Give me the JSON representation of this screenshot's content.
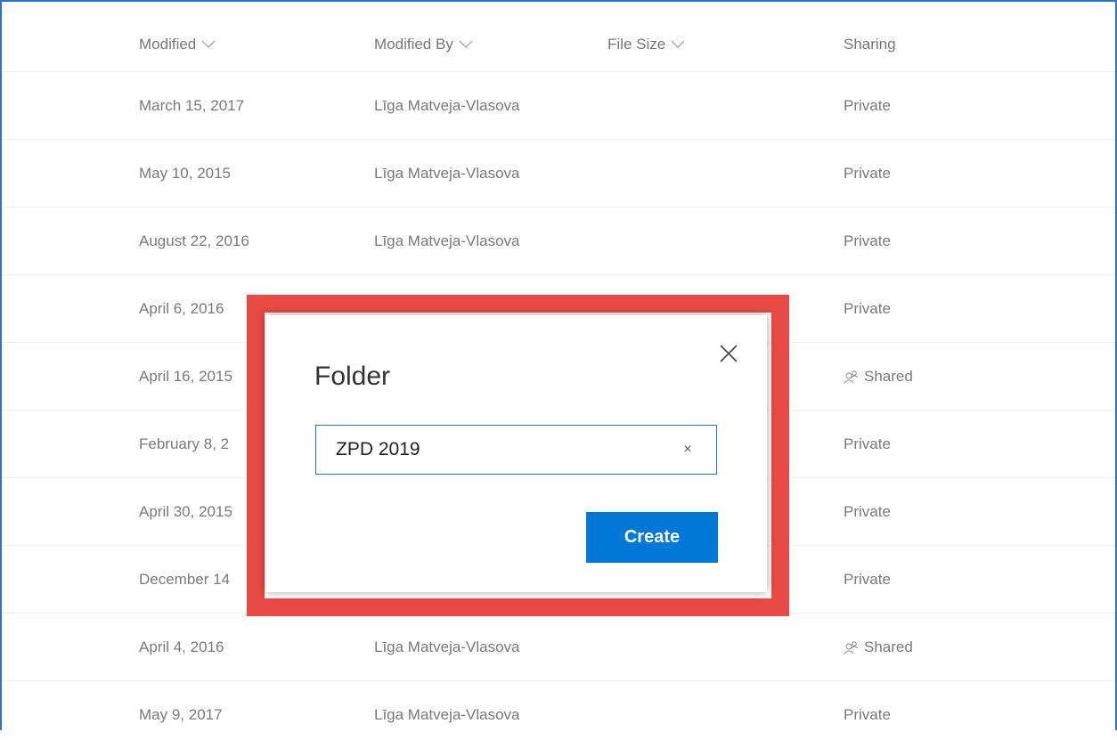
{
  "columns": {
    "modified": "Modified",
    "modified_by": "Modified By",
    "file_size": "File Size",
    "sharing": "Sharing"
  },
  "rows": [
    {
      "modified": "March 15, 2017",
      "modified_by": "Līga Matveja-Vlasova",
      "file_size": "",
      "sharing": "Private",
      "shared": false
    },
    {
      "modified": "May 10, 2015",
      "modified_by": "Līga Matveja-Vlasova",
      "file_size": "",
      "sharing": "Private",
      "shared": false
    },
    {
      "modified": "August 22, 2016",
      "modified_by": "Līga Matveja-Vlasova",
      "file_size": "",
      "sharing": "Private",
      "shared": false
    },
    {
      "modified": "April 6, 2016",
      "modified_by": "",
      "file_size": "",
      "sharing": "Private",
      "shared": false
    },
    {
      "modified": "April 16, 2015",
      "modified_by": "",
      "file_size": "",
      "sharing": "Shared",
      "shared": true
    },
    {
      "modified": "February 8, 2",
      "modified_by": "",
      "file_size": "",
      "sharing": "Private",
      "shared": false
    },
    {
      "modified": "April 30, 2015",
      "modified_by": "",
      "file_size": "",
      "sharing": "Private",
      "shared": false
    },
    {
      "modified": "December 14",
      "modified_by": "",
      "file_size": "",
      "sharing": "Private",
      "shared": false
    },
    {
      "modified": "April 4, 2016",
      "modified_by": "Līga Matveja-Vlasova",
      "file_size": "",
      "sharing": "Shared",
      "shared": true
    },
    {
      "modified": "May 9, 2017",
      "modified_by": "Līga Matveja-Vlasova",
      "file_size": "",
      "sharing": "Private",
      "shared": false
    }
  ],
  "dialog": {
    "title": "Folder",
    "input_value": "ZPD 2019",
    "clear_label": "×",
    "create_label": "Create",
    "close_icon": "close-icon"
  },
  "colors": {
    "frame": "#2b74c8",
    "highlight": "#e84b43",
    "primary_button": "#0078d7"
  }
}
